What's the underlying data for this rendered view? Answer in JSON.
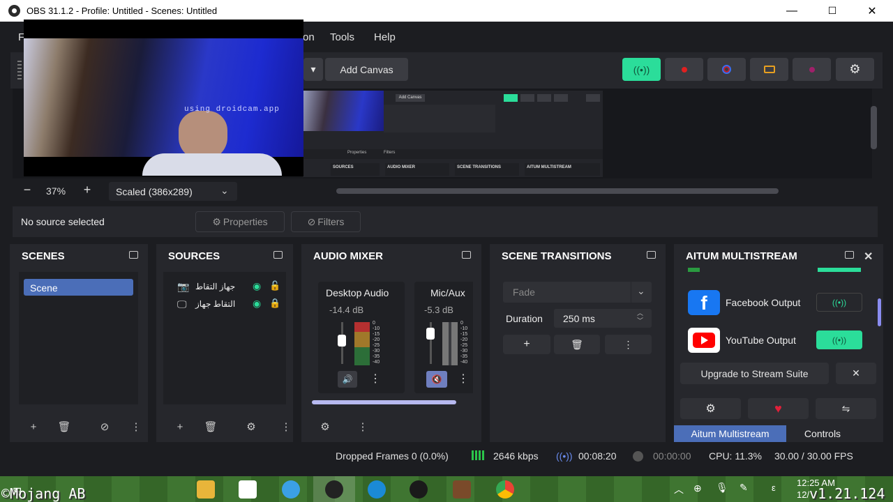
{
  "window": {
    "title": "OBS 31.1.2 - Profile: Untitled - Scenes: Untitled",
    "minimize": "—",
    "maximize": "☐",
    "close": "✕"
  },
  "menu": {
    "partial_left": "F",
    "partial_mid": "on",
    "tools": "Tools",
    "help": "Help"
  },
  "toolbar": {
    "add_canvas": "Add Canvas"
  },
  "webcam": {
    "watermark": "using droidcam.app"
  },
  "thumb": {
    "add_canvas": "Add Canvas",
    "docks": [
      "SOURCES",
      "AUDIO MIXER",
      "SCENE TRANSITIONS",
      "AITUM MULTISTREAM"
    ],
    "props": "Properties",
    "filters": "Filters"
  },
  "zoom": {
    "minus": "−",
    "value": "37%",
    "plus": "+",
    "scale": "Scaled (386x289)"
  },
  "source_bar": {
    "no_source": "No source selected",
    "properties": "Properties",
    "filters": "Filters"
  },
  "scenes": {
    "title": "SCENES",
    "items": [
      "Scene"
    ]
  },
  "sources": {
    "title": "SOURCES",
    "items": [
      {
        "name": "جهاز التقاط",
        "icon": "camera-icon"
      },
      {
        "name": "التقاط جهاز",
        "icon": "monitor-icon"
      }
    ]
  },
  "audio": {
    "title": "AUDIO MIXER",
    "channels": [
      {
        "name": "Desktop Audio",
        "db": "-14.4 dB",
        "level": 0.62
      },
      {
        "name": "Mic/Aux",
        "db": "-5.3 dB",
        "level": 0.85
      }
    ],
    "scale": [
      "0",
      "-10",
      "-15",
      "-20",
      "-25",
      "-30",
      "-35",
      "-40"
    ]
  },
  "transitions": {
    "title": "SCENE TRANSITIONS",
    "selected": "Fade",
    "duration_label": "Duration",
    "duration_value": "250 ms"
  },
  "aitum": {
    "title": "AITUM MULTISTREAM",
    "outputs": [
      {
        "name": "Facebook Output",
        "active": false
      },
      {
        "name": "YouTube Output",
        "active": true
      }
    ],
    "upgrade": "Upgrade to Stream Suite",
    "tabs": [
      "Aitum Multistream",
      "Controls"
    ]
  },
  "status": {
    "dropped": "Dropped Frames 0 (0.0%)",
    "kbps": "2646 kbps",
    "stream_time": "00:08:20",
    "rec_time": "00:00:00",
    "cpu": "CPU: 11.3%",
    "fps": "30.00 / 30.00 FPS"
  },
  "overlay": {
    "left": "©Mojang AB",
    "right": "v1.21.124"
  },
  "taskbar": {
    "time": "12:25 AM",
    "date": "12/"
  },
  "colors": {
    "accent_green": "#2bdd9a",
    "record_red": "#e02020",
    "panel": "#26272c"
  }
}
